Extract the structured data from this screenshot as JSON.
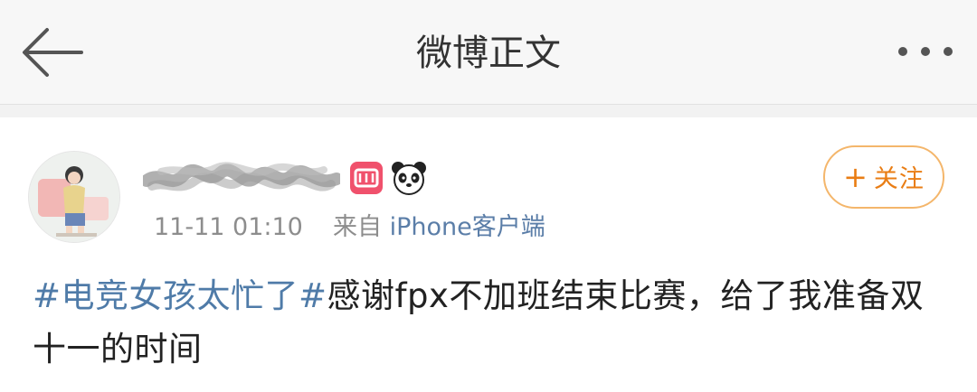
{
  "header": {
    "title": "微博正文",
    "back_icon": "arrow-left-icon",
    "more_icon": "more-horizontal-icon"
  },
  "post": {
    "author_name_censored": true,
    "verified_badge_icon": "vip-badge-icon",
    "decoration_icon": "panda-icon",
    "time": "11-11 01:10",
    "source_prefix": "来自",
    "source": "iPhone客户端",
    "follow_label": "关注",
    "follow_icon": "plus-icon",
    "topic": "#电竞女孩太忙了#",
    "text": "感谢fpx不加班结束比赛，给了我准备双十一的时间"
  },
  "colors": {
    "header_bg": "#f7f7f7",
    "link": "#5b7ea8",
    "follow_accent": "#e97d14",
    "follow_border": "#f4b66b"
  }
}
